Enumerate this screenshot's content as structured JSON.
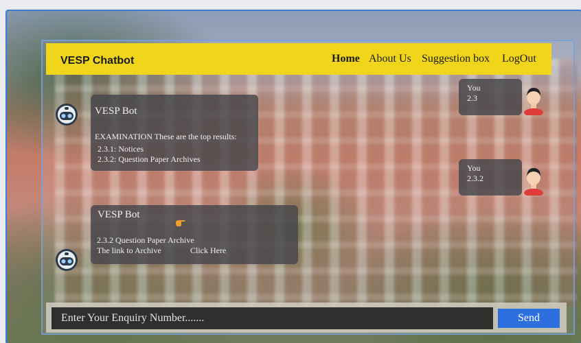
{
  "app": {
    "brand": "VESP Chatbot"
  },
  "nav": {
    "home": "Home",
    "about": "About Us",
    "suggestion": "Suggestion box",
    "logout": "LogOut"
  },
  "messages": {
    "user1": {
      "sender": "You",
      "text": "2.3"
    },
    "bot1": {
      "sender": "VESP Bot",
      "heading": "EXAMINATION These are the top results:",
      "items": [
        "2.3.1: Notices",
        "2.3.2: Question Paper Archives"
      ]
    },
    "user2": {
      "sender": "You",
      "text": "2.3.2"
    },
    "bot2": {
      "sender": "VESP Bot",
      "line1": "2.3.2 Question Paper Archive",
      "line2": "The link to Archive",
      "link": "Click Here"
    }
  },
  "composer": {
    "placeholder": "Enter Your Enquiry Number.......",
    "send_label": "Send"
  },
  "colors": {
    "navbar": "#f0d51a",
    "send": "#2e6fe0",
    "bubble": "#46464b"
  }
}
